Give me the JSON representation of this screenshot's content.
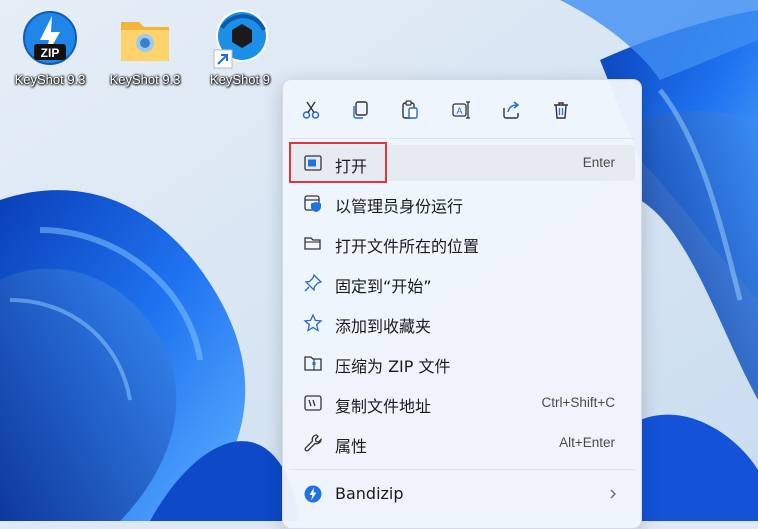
{
  "desktop": {
    "icons": [
      {
        "label": "KeyShot 9.3",
        "icon": "bandizip-zip-icon"
      },
      {
        "label": "KeyShot 9.3",
        "icon": "folder-icon"
      },
      {
        "label": "KeyShot 9",
        "icon": "keyshot-shortcut-icon"
      }
    ]
  },
  "toolbar": {
    "buttons": [
      {
        "icon": "cut-icon"
      },
      {
        "icon": "copy-icon"
      },
      {
        "icon": "paste-icon"
      },
      {
        "icon": "rename-icon"
      },
      {
        "icon": "share-icon"
      },
      {
        "icon": "delete-icon"
      }
    ],
    "accent": "#2b6cc4"
  },
  "menu": {
    "items": [
      {
        "label": "打开",
        "shortcut": "Enter",
        "icon": "open-window-icon",
        "highlighted": true
      },
      {
        "label": "以管理员身份运行",
        "shortcut": "",
        "icon": "shield-run-as-admin-icon"
      },
      {
        "label": "打开文件所在的位置",
        "shortcut": "",
        "icon": "folder-open-icon"
      },
      {
        "label": "固定到“开始”",
        "shortcut": "",
        "icon": "pin-icon"
      },
      {
        "label": "添加到收藏夹",
        "shortcut": "",
        "icon": "star-icon"
      },
      {
        "label": "压缩为 ZIP 文件",
        "shortcut": "",
        "icon": "zip-folder-icon"
      },
      {
        "label": "复制文件地址",
        "shortcut": "Ctrl+Shift+C",
        "icon": "copy-path-icon"
      },
      {
        "label": "属性",
        "shortcut": "Alt+Enter",
        "icon": "wrench-properties-icon"
      }
    ],
    "submenu": {
      "label": "Bandizip",
      "icon": "bandizip-icon",
      "arrow": "chevron-right-icon"
    }
  },
  "colors": {
    "highlight_box": "#e0353b",
    "wallpaper_blue": "#1a5fd6"
  }
}
